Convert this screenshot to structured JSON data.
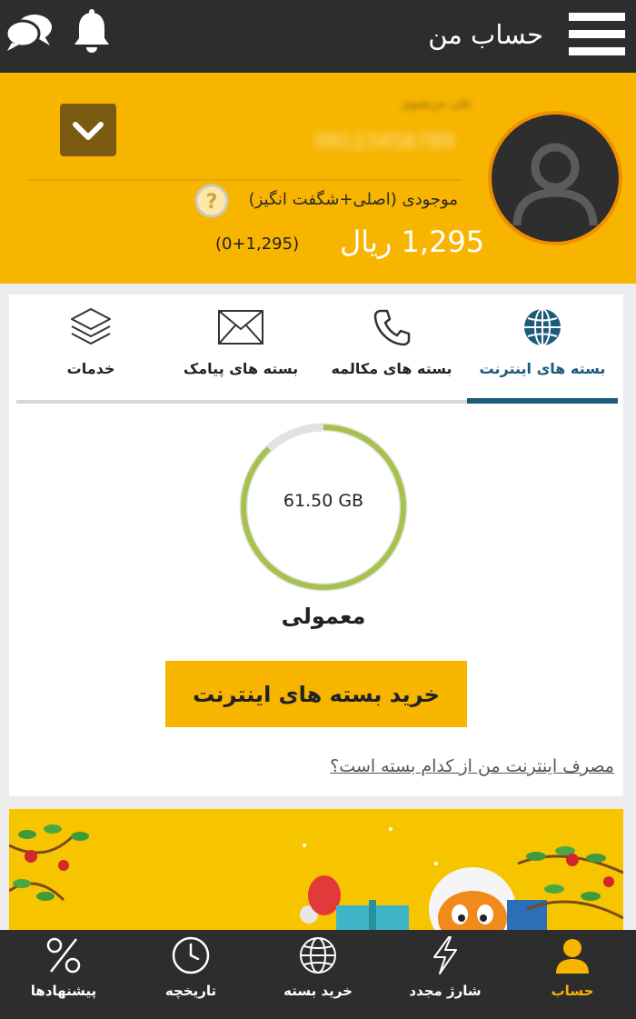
{
  "header": {
    "title": "حساب من",
    "menu_icon": "hamburger-menu-icon",
    "bell_icon": "bell-icon",
    "chat_icon": "chat-bubbles-icon"
  },
  "account": {
    "user_name": "علی مرتضوی",
    "phone": "09123456789",
    "balance_label": "موجودی (اصلی+شگفت انگیز)",
    "balance_value": "1,295 ریال",
    "balance_detail": "(0+1,295)"
  },
  "tabs": [
    {
      "label": "بسته های اینترنت",
      "icon": "globe-icon",
      "active": true
    },
    {
      "label": "بسته های مکالمه",
      "icon": "phone-icon",
      "active": false
    },
    {
      "label": "بسته های پیامک",
      "icon": "envelope-icon",
      "active": false
    },
    {
      "label": "خدمات",
      "icon": "layers-icon",
      "active": false
    }
  ],
  "package": {
    "remaining": "61.50 GB",
    "remaining_fraction": 0.88,
    "plan": "معمولی",
    "buy_button": "خرید بسته های اینترنت",
    "usage_link": "مصرف اینترنت من از کدام بسته است؟"
  },
  "bottom_nav": [
    {
      "label": "حساب",
      "icon": "user-icon",
      "active": true
    },
    {
      "label": "شارژ مجدد",
      "icon": "lightning-icon",
      "active": false
    },
    {
      "label": "خرید بسته",
      "icon": "globe-icon",
      "active": false
    },
    {
      "label": "تاریخچه",
      "icon": "clock-icon",
      "active": false
    },
    {
      "label": "پیشنهادها",
      "icon": "percent-icon",
      "active": false
    }
  ],
  "colors": {
    "accent": "#f7b500",
    "dark": "#2d2d2d",
    "tab_active": "#1d5b7b",
    "ring_progress": "#a7c14d"
  }
}
